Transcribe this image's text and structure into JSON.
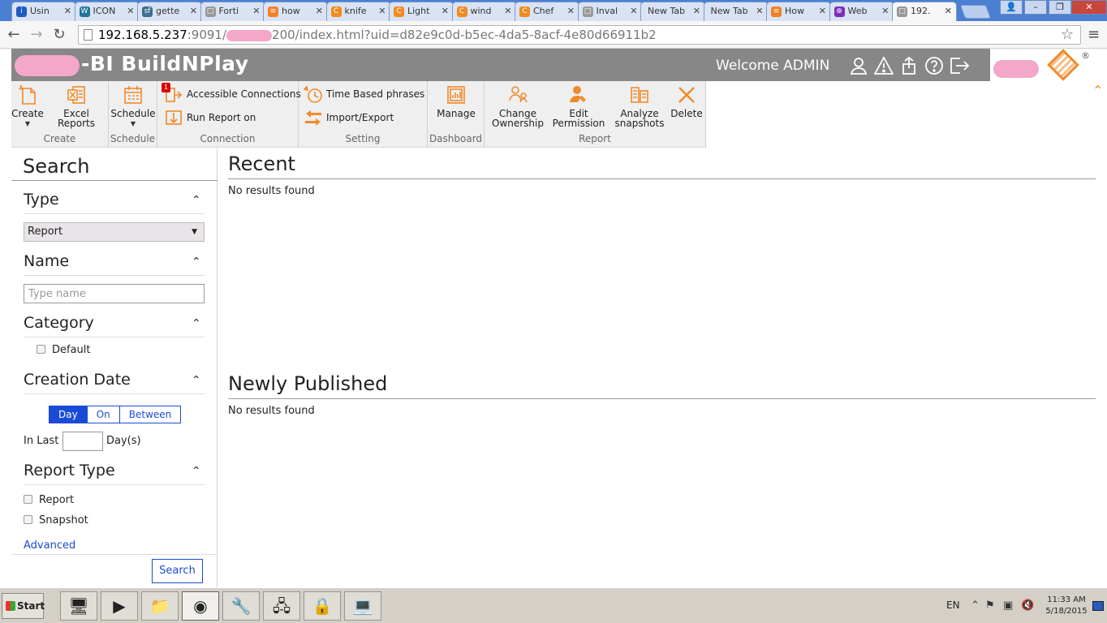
{
  "browser": {
    "tabs": [
      {
        "label": "Usin",
        "fav": "i",
        "color": "#1e5bc6"
      },
      {
        "label": "ICON",
        "fav": "W",
        "color": "#21759b"
      },
      {
        "label": "gette",
        "fav": "sf",
        "color": "#3b6f8f"
      },
      {
        "label": "Forti",
        "fav": "□",
        "color": "#999999"
      },
      {
        "label": "how",
        "fav": "≡",
        "color": "#f48024"
      },
      {
        "label": "knife",
        "fav": "C",
        "color": "#f18b21"
      },
      {
        "label": "Light",
        "fav": "C",
        "color": "#f18b21"
      },
      {
        "label": "wind",
        "fav": "C",
        "color": "#f18b21"
      },
      {
        "label": "Chef",
        "fav": "C",
        "color": "#f18b21"
      },
      {
        "label": "Inval",
        "fav": "□",
        "color": "#999999"
      },
      {
        "label": "New Tab",
        "fav": "",
        "color": ""
      },
      {
        "label": "New Tab",
        "fav": "",
        "color": ""
      },
      {
        "label": "How",
        "fav": "≡",
        "color": "#f48024"
      },
      {
        "label": "Web",
        "fav": "⊕",
        "color": "#7a2fb8"
      },
      {
        "label": "192.",
        "fav": "□",
        "color": "#999999"
      }
    ],
    "tab_close_glyph": "✕",
    "url_host": "192.168.5.237",
    "url_port": ":9091/",
    "url_rest": "200/index.html?uid=d82e9c0d-b5ec-4da5-8acf-4e80d66911b2"
  },
  "header": {
    "brand": "-BI BuildNPlay",
    "welcome": "Welcome ADMIN",
    "icons": [
      "user-icon",
      "warning-icon",
      "upload-icon",
      "help-icon",
      "logout-icon"
    ],
    "logo_mark": "®",
    "accent": "#f08a2b"
  },
  "ribbon": {
    "create": {
      "button": "Create",
      "excel": "Excel\nReports",
      "group": "Create"
    },
    "schedule": {
      "button": "Schedule",
      "group": "Schedule"
    },
    "connection": {
      "accessible": "Accessible Connections",
      "run": "Run Report on",
      "badge": "1",
      "group": "Connection"
    },
    "setting": {
      "time": "Time Based phrases",
      "import": "Import/Export",
      "group": "Setting"
    },
    "dashboard": {
      "manage": "Manage",
      "group": "Dashboard"
    },
    "report": {
      "change": "Change\nOwnership",
      "edit": "Edit\nPermission",
      "analyze": "Analyze\nsnapshots",
      "delete": "Delete",
      "group": "Report"
    }
  },
  "search": {
    "title": "Search",
    "type": {
      "title": "Type",
      "selected": "Report"
    },
    "name": {
      "title": "Name",
      "placeholder": "Type name"
    },
    "category": {
      "title": "Category",
      "options": [
        "Default"
      ]
    },
    "creation_date": {
      "title": "Creation Date",
      "modes": [
        "Day",
        "On",
        "Between"
      ],
      "active_mode": "Day",
      "in_last": "In Last",
      "days": "Day(s)"
    },
    "report_type": {
      "title": "Report Type",
      "options": [
        "Report",
        "Snapshot"
      ]
    },
    "advanced": "Advanced",
    "button": "Search"
  },
  "main": {
    "recent": {
      "title": "Recent",
      "empty": "No results found"
    },
    "newly": {
      "title": "Newly Published",
      "empty": "No results found"
    }
  },
  "taskbar": {
    "start": "Start",
    "lang": "EN",
    "time": "11:33 AM",
    "date": "5/18/2015"
  }
}
